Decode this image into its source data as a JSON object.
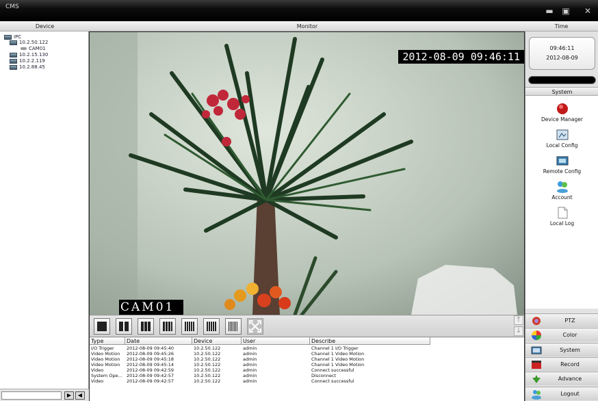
{
  "window": {
    "title": "CMS"
  },
  "headers": {
    "device": "Device",
    "monitor": "Monitor",
    "time": "Time"
  },
  "tree": {
    "root": "IPC",
    "items": [
      {
        "label": "10.2.50.122",
        "icon": "pc-icon",
        "indent": 1
      },
      {
        "label": "CAM01",
        "icon": "camera-icon",
        "indent": 2
      },
      {
        "label": "10.2.15.130",
        "icon": "pc-icon",
        "indent": 1
      },
      {
        "label": "10.2.2.119",
        "icon": "pc-icon",
        "indent": 1
      },
      {
        "label": "10.2.88.45",
        "icon": "pc-icon",
        "indent": 1
      }
    ]
  },
  "video": {
    "timestamp": "2012-08-09 09:46:11",
    "camera_label": "CAM01"
  },
  "clock": {
    "time": "09:46:11",
    "date": "2012-08-09"
  },
  "system": {
    "header": "System",
    "items": [
      {
        "label": "Device Manager",
        "icon": "device-manager-icon"
      },
      {
        "label": "Local Config",
        "icon": "local-config-icon"
      },
      {
        "label": "Remote Config",
        "icon": "remote-config-icon"
      },
      {
        "label": "Account",
        "icon": "account-icon"
      },
      {
        "label": "Local Log",
        "icon": "local-log-icon"
      }
    ]
  },
  "right_buttons": [
    {
      "label": "PTZ",
      "icon": "ptz-icon"
    },
    {
      "label": "Color",
      "icon": "color-icon"
    },
    {
      "label": "System",
      "icon": "system-icon"
    },
    {
      "label": "Record",
      "icon": "record-icon"
    },
    {
      "label": "Advance",
      "icon": "advance-icon"
    },
    {
      "label": "Logout",
      "icon": "logout-icon"
    }
  ],
  "log": {
    "columns": [
      "Type",
      "Date",
      "Device",
      "User",
      "Describe"
    ],
    "rows": [
      [
        "I/O Trigger",
        "2012-08-09 09:45:40",
        "10.2.50.122",
        "admin",
        "Channel 1 I/O Trigger"
      ],
      [
        "Video Motion",
        "2012-08-09 09:45:26",
        "10.2.50.122",
        "admin",
        "Channel 1 Video Motion"
      ],
      [
        "Video Motion",
        "2012-08-09 09:45:18",
        "10.2.50.122",
        "admin",
        "Channel 1 Video Motion"
      ],
      [
        "Video Motion",
        "2012-08-09 09:45:14",
        "10.2.50.122",
        "admin",
        "Channel 1 Video Motion"
      ],
      [
        "Video",
        "2012-08-09 09:42:59",
        "10.2.50.122",
        "admin",
        "Connect successful"
      ],
      [
        "System Ope...",
        "2012-08-09 09:42:57",
        "10.2.50.122",
        "admin",
        "Disconnect"
      ],
      [
        "Video",
        "2012-08-09 09:42:57",
        "10.2.50.122",
        "admin",
        "Connect successful"
      ]
    ]
  },
  "layout_buttons": [
    "1-split",
    "4-split",
    "9-split",
    "16-split",
    "25-split",
    "36-split",
    "64-split",
    "fullscreen"
  ],
  "colors": {
    "titlebar": "#000000",
    "video_bg": "#b9c5bb",
    "panel": "#e2e2e2"
  }
}
